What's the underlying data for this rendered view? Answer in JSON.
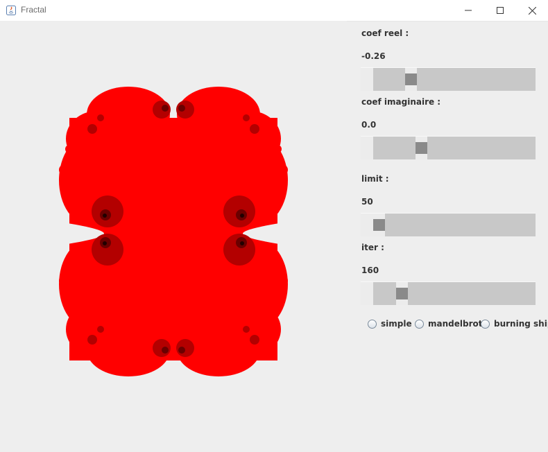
{
  "window": {
    "title": "Fractal"
  },
  "controls": {
    "real": {
      "label": "coef reel :",
      "value": "-0.26",
      "position": 0.21
    },
    "imag": {
      "label": "coef imaginaire :",
      "value": "0.0",
      "position": 0.28
    },
    "limit": {
      "label": "limit :",
      "value": "50",
      "position": 0.0
    },
    "iter": {
      "label": "iter :",
      "value": "160",
      "position": 0.15
    }
  },
  "modes": [
    {
      "label": "simple",
      "selected": false
    },
    {
      "label": "mandelbrot",
      "selected": false
    },
    {
      "label": "burning ship",
      "selected": false
    }
  ],
  "colors": {
    "fractal": "#ff0000",
    "fractal_dark": "#b00000",
    "background": "#eeeeee"
  }
}
